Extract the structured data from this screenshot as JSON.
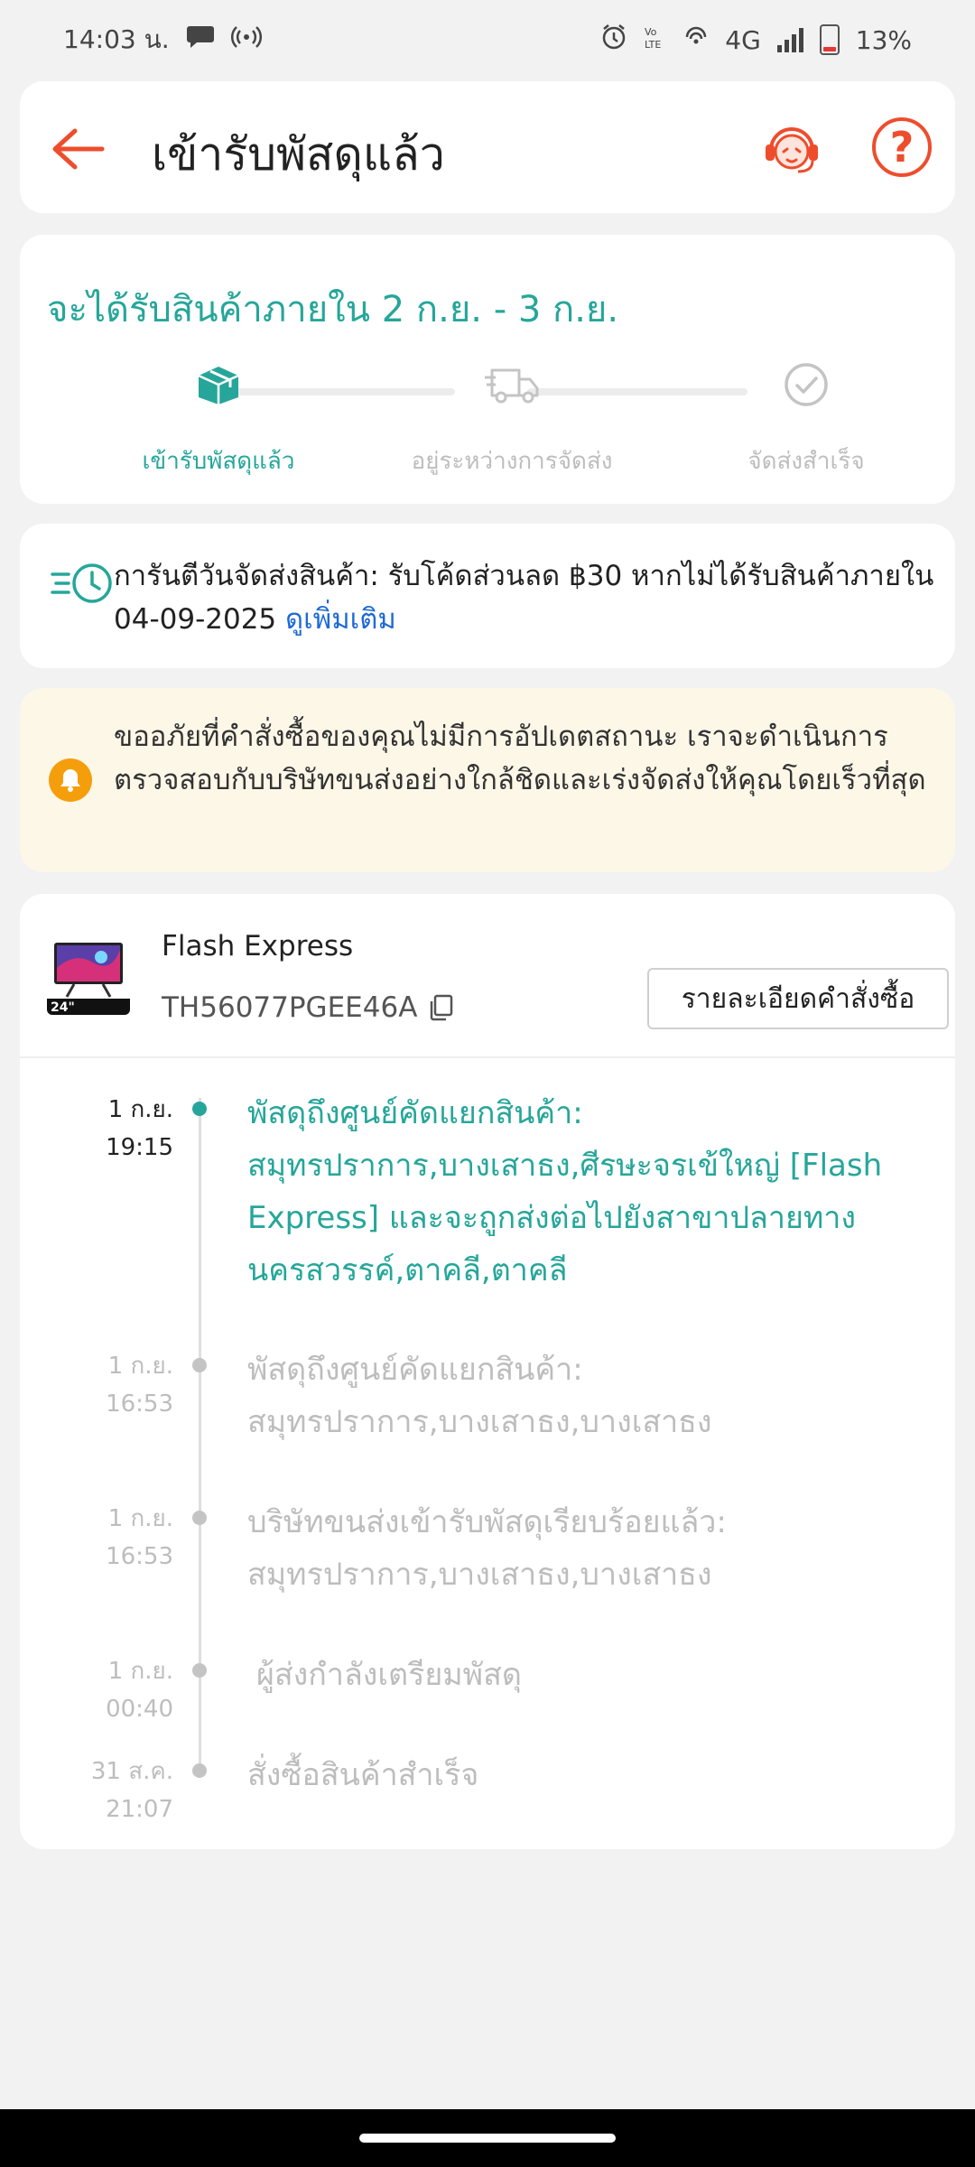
{
  "status_bar": {
    "time": "14:03 น.",
    "network": "4G",
    "battery": "13%"
  },
  "header": {
    "title": "เข้ารับพัสดุแล้ว"
  },
  "delivery": {
    "eta": "จะได้รับสินค้าภายใน 2 ก.ย. - 3 ก.ย.",
    "steps": [
      {
        "label": "เข้ารับพัสดุแล้ว",
        "active": true
      },
      {
        "label": "อยู่ระหว่างการจัดส่ง",
        "active": false
      },
      {
        "label": "จัดส่งสำเร็จ",
        "active": false
      }
    ],
    "accent_color": "#26a69a"
  },
  "guarantee": {
    "text": "การันตีวันจัดส่งสินค้า: รับโค้ดส่วนลด ฿30 หากไม่ได้รับสินค้าภายใน 04-09-2025",
    "link": "ดูเพิ่มเติม"
  },
  "notice": {
    "text": "ขออภัยที่คำสั่งซื้อของคุณไม่มีการอัปเดตสถานะ เราจะดำเนินการตรวจสอบกับบริษัทขนส่งอย่างใกล้ชิดและเร่งจัดส่งให้คุณโดยเร็วที่สุด"
  },
  "shipment": {
    "carrier": "Flash Express",
    "tracking_number": "TH56077PGEE46A",
    "order_details_label": "รายละเอียดคำสั่งซื้อ",
    "thumbnail_badge": "24\""
  },
  "timeline": [
    {
      "date": "1 ก.ย.",
      "time": "19:15",
      "description": "พัสดุถึงศูนย์คัดแยกสินค้า: สมุทรปราการ,บางเสาธง,ศีรษะจรเข้ใหญ่ [Flash Express] และจะถูกส่งต่อไปยังสาขาปลายทาง นครสวรรค์,ตาคลี,ตาคลี",
      "current": true
    },
    {
      "date": "1 ก.ย.",
      "time": "16:53",
      "description": "พัสดุถึงศูนย์คัดแยกสินค้า: สมุทรปราการ,บางเสาธง,บางเสาธง",
      "current": false
    },
    {
      "date": "1 ก.ย.",
      "time": "16:53",
      "description": "บริษัทขนส่งเข้ารับพัสดุเรียบร้อยแล้ว: สมุทรปราการ,บางเสาธง,บางเสาธง",
      "current": false
    },
    {
      "date": "1 ก.ย.",
      "time": "00:40",
      "description": "ผู้ส่งกำลังเตรียมพัสดุ",
      "current": false
    },
    {
      "date": "31 ส.ค.",
      "time": "21:07",
      "description": "สั่งซื้อสินค้าสำเร็จ",
      "current": false
    }
  ]
}
